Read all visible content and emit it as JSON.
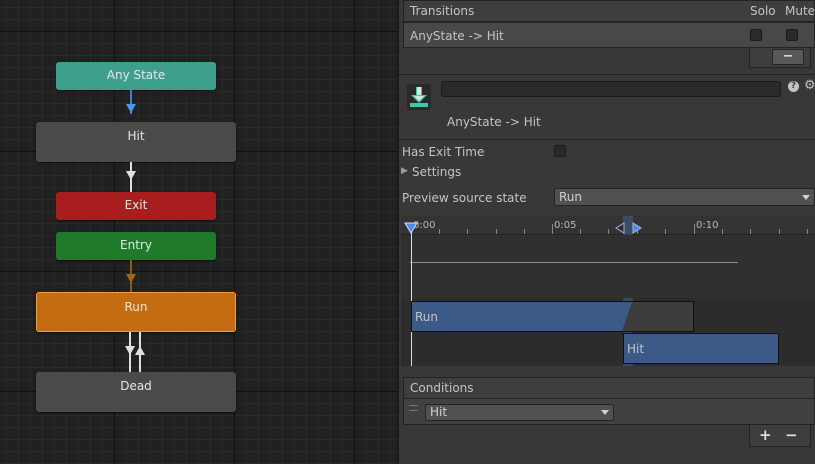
{
  "graph": {
    "nodes": {
      "any_state": "Any State",
      "hit": "Hit",
      "exit": "Exit",
      "entry": "Entry",
      "run": "Run",
      "dead": "Dead"
    },
    "colors": {
      "any_state": "#3f9f8d",
      "default": "#4a4a4a",
      "exit": "#a81e1e",
      "entry": "#1f7a2c",
      "run": "#c56c12"
    }
  },
  "inspector": {
    "transitions_header": "Transitions",
    "solo_label": "Solo",
    "mute_label": "Mute",
    "transitions": [
      {
        "name": "AnyState -> Hit",
        "solo": false,
        "mute": false
      }
    ],
    "remove_symbol": "−",
    "transition_name_field": "",
    "transition_title": "AnyState -> Hit",
    "has_exit_time_label": "Has Exit Time",
    "has_exit_time": false,
    "settings_label": "Settings",
    "preview_source_label": "Preview source state",
    "preview_source_value": "Run",
    "timeline": {
      "ticks": [
        "0:00",
        "0:05",
        "0:10"
      ],
      "source_clip": "Run",
      "target_clip": "Hit"
    },
    "conditions_header": "Conditions",
    "conditions": [
      {
        "parameter": "Hit"
      }
    ],
    "add_symbol": "+",
    "remove_condition_symbol": "−"
  }
}
